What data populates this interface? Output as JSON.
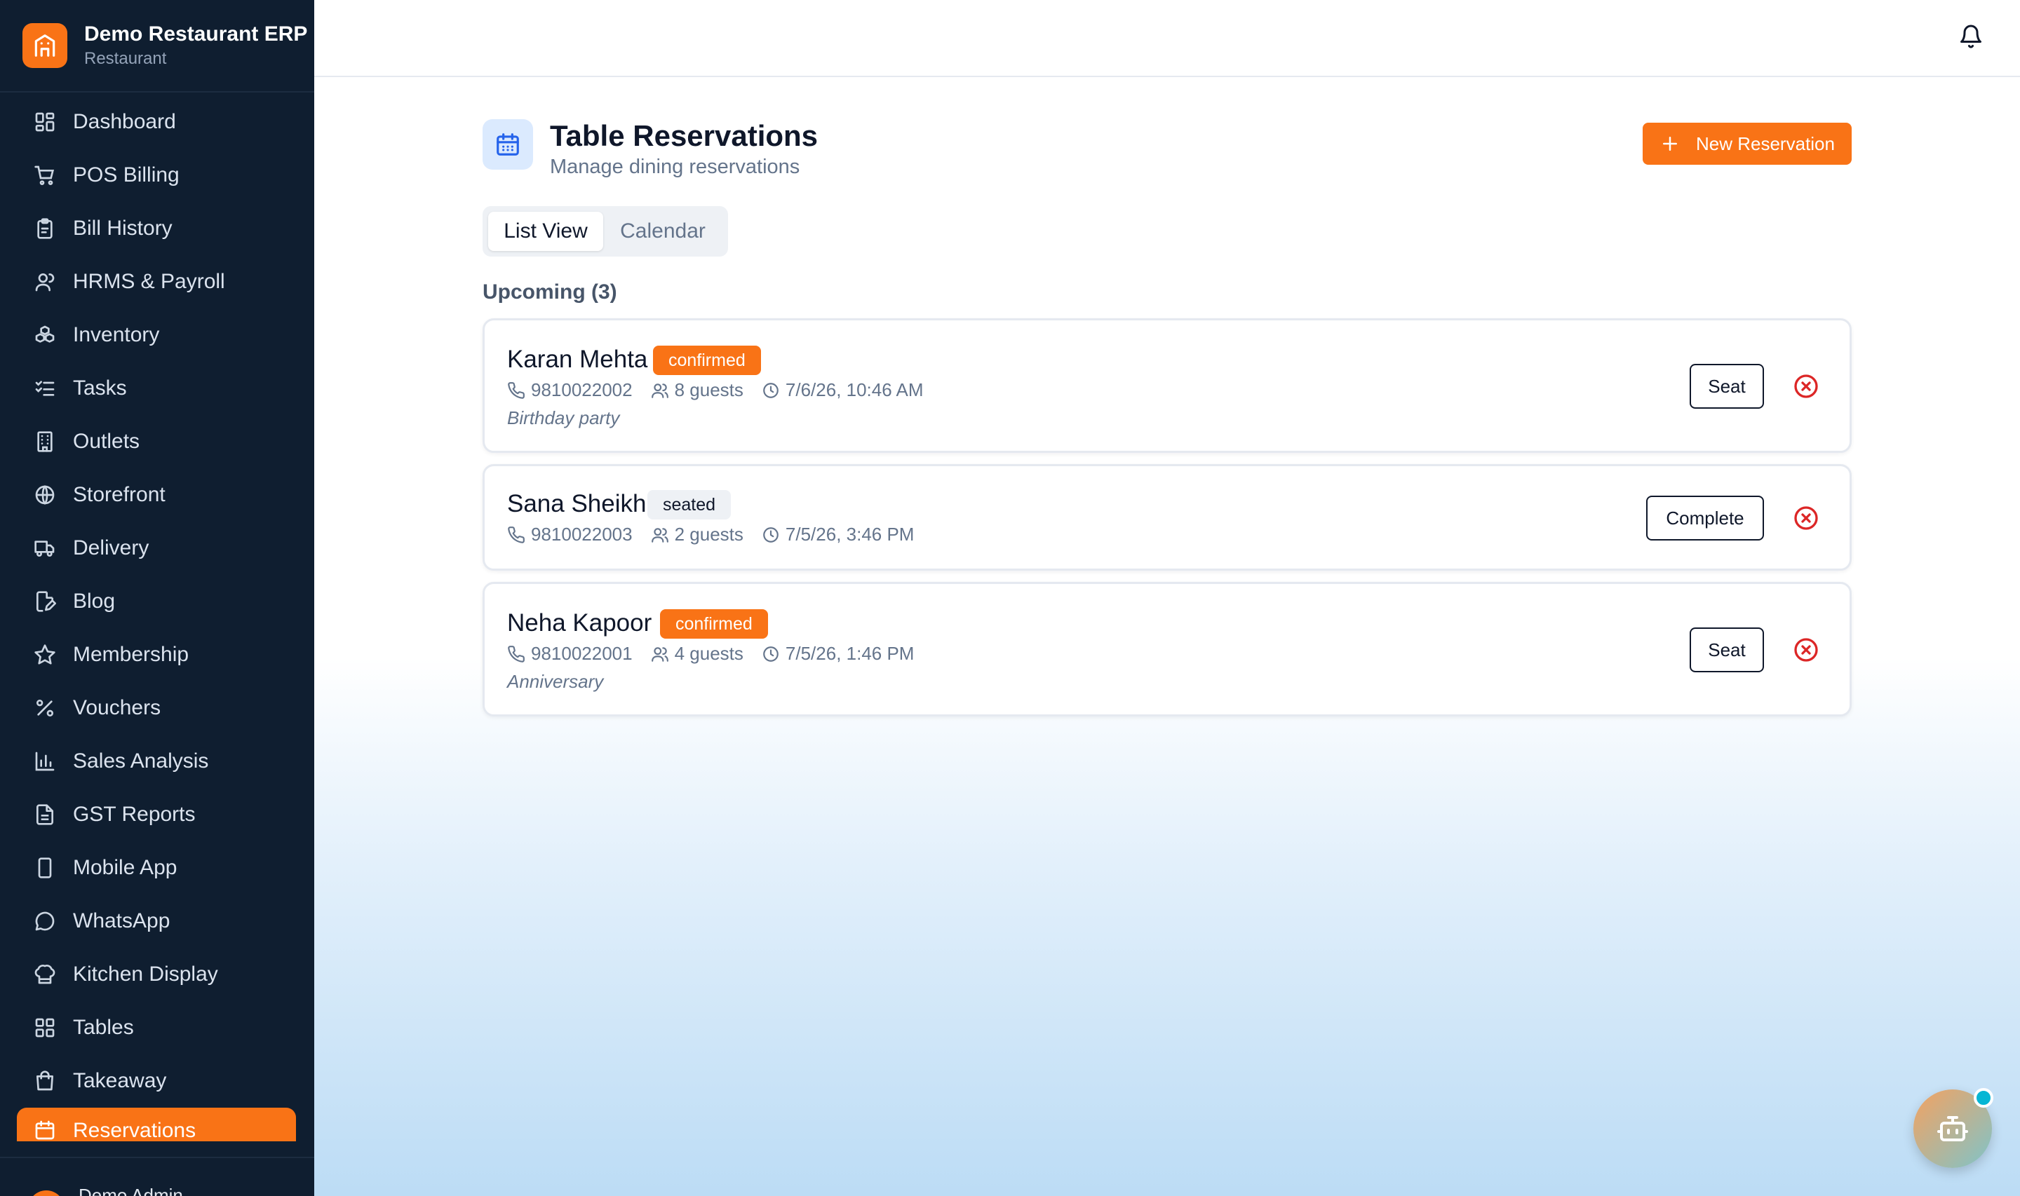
{
  "brand": {
    "name": "Demo Restaurant ERP",
    "subtitle": "Restaurant"
  },
  "sidebar": {
    "items": [
      {
        "label": "Dashboard",
        "icon": "dashboard-icon"
      },
      {
        "label": "POS Billing",
        "icon": "cart-icon"
      },
      {
        "label": "Bill History",
        "icon": "clipboard-icon"
      },
      {
        "label": "HRMS & Payroll",
        "icon": "user-icon"
      },
      {
        "label": "Inventory",
        "icon": "boxes-icon"
      },
      {
        "label": "Tasks",
        "icon": "checklist-icon"
      },
      {
        "label": "Outlets",
        "icon": "building-icon"
      },
      {
        "label": "Storefront",
        "icon": "globe-icon"
      },
      {
        "label": "Delivery",
        "icon": "truck-icon"
      },
      {
        "label": "Blog",
        "icon": "file-pen-icon"
      },
      {
        "label": "Membership",
        "icon": "star-icon"
      },
      {
        "label": "Vouchers",
        "icon": "percent-icon"
      },
      {
        "label": "Sales Analysis",
        "icon": "bar-chart-icon"
      },
      {
        "label": "GST Reports",
        "icon": "file-text-icon"
      },
      {
        "label": "Mobile App",
        "icon": "smartphone-icon"
      },
      {
        "label": "WhatsApp",
        "icon": "message-circle-icon"
      },
      {
        "label": "Kitchen Display",
        "icon": "chef-hat-icon"
      },
      {
        "label": "Tables",
        "icon": "grid-icon"
      },
      {
        "label": "Takeaway",
        "icon": "shopping-bag-icon"
      },
      {
        "label": "Reservations",
        "icon": "calendar-icon",
        "active": true
      }
    ],
    "user_name": "Demo Admin"
  },
  "page": {
    "title": "Table Reservations",
    "subtitle": "Manage dining reservations",
    "new_button": "New Reservation",
    "tabs": [
      {
        "label": "List View",
        "active": true
      },
      {
        "label": "Calendar",
        "active": false
      }
    ],
    "section_title": "Upcoming (3)"
  },
  "reservations": [
    {
      "name": "Karan Mehta",
      "status": "confirmed",
      "phone": "9810022002",
      "guests": "8 guests",
      "time": "7/6/26, 10:46 AM",
      "note": "Birthday party",
      "action": "Seat"
    },
    {
      "name": "Sana Sheikh",
      "status": "seated",
      "phone": "9810022003",
      "guests": "2 guests",
      "time": "7/5/26, 3:46 PM",
      "note": "",
      "action": "Complete"
    },
    {
      "name": "Neha Kapoor",
      "status": "confirmed",
      "phone": "9810022001",
      "guests": "4 guests",
      "time": "7/5/26, 1:46 PM",
      "note": "Anniversary",
      "action": "Seat"
    }
  ],
  "colors": {
    "accent": "#f97316",
    "sidebar_bg": "#0f1e30",
    "cancel": "#dc2626",
    "status_dot": "#06b6d4"
  }
}
